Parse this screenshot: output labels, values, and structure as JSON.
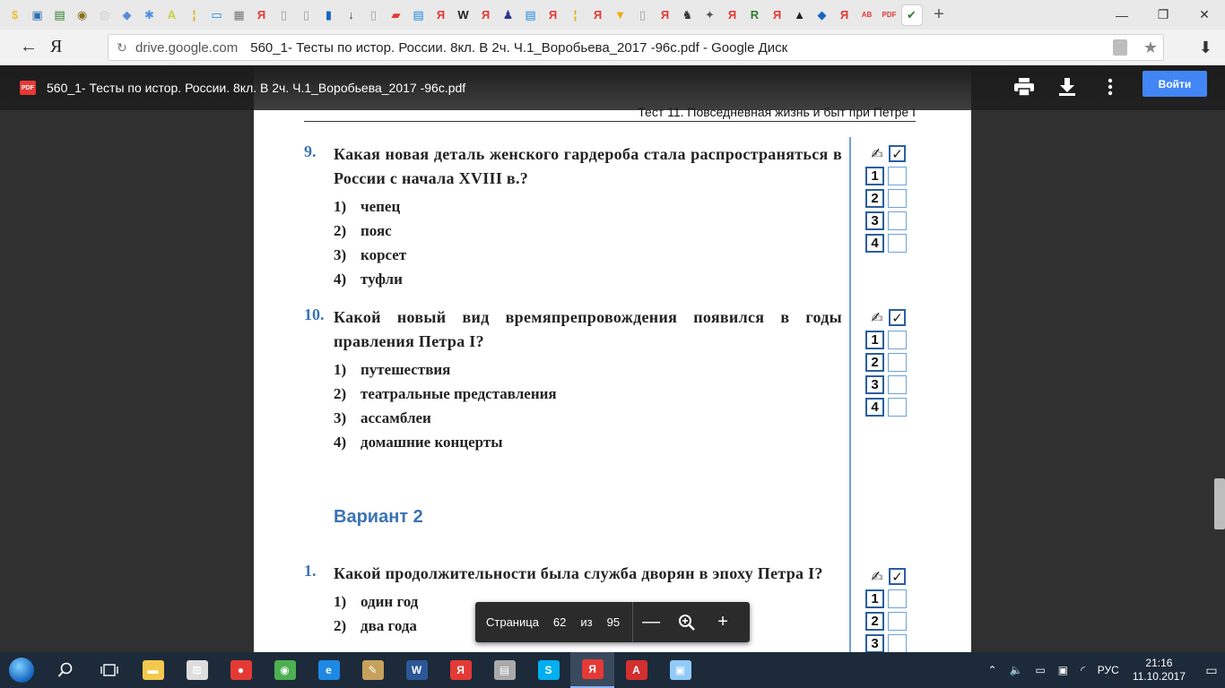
{
  "browser": {
    "tab_icons": [
      {
        "glyph": "$",
        "color": "#e9c23a"
      },
      {
        "glyph": "▣",
        "color": "#2f6fb3"
      },
      {
        "glyph": "▤",
        "color": "#2e7d32"
      },
      {
        "glyph": "◉",
        "color": "#8d6e1f"
      },
      {
        "glyph": "◎",
        "color": "#c8c8c8"
      },
      {
        "glyph": "◆",
        "color": "#5b8bd6"
      },
      {
        "glyph": "✱",
        "color": "#4a90e2"
      },
      {
        "glyph": "A",
        "color": "#c6d33b"
      },
      {
        "glyph": "¦",
        "color": "#e0b000"
      },
      {
        "glyph": "▭",
        "color": "#1e88e5"
      },
      {
        "glyph": "▦",
        "color": "#777777"
      },
      {
        "glyph": "Я",
        "color": "#e53935"
      },
      {
        "glyph": "▯",
        "color": "#9e9e9e"
      },
      {
        "glyph": "▯",
        "color": "#9e9e9e"
      },
      {
        "glyph": "▮",
        "color": "#1565c0"
      },
      {
        "glyph": "↓",
        "color": "#424242"
      },
      {
        "glyph": "▯",
        "color": "#9e9e9e"
      },
      {
        "glyph": "▰",
        "color": "#e53935"
      },
      {
        "glyph": "▤",
        "color": "#1e88e5"
      },
      {
        "glyph": "Я",
        "color": "#e53935"
      },
      {
        "glyph": "W",
        "color": "#222222"
      },
      {
        "glyph": "Я",
        "color": "#e53935"
      },
      {
        "glyph": "♟",
        "color": "#283593"
      },
      {
        "glyph": "▤",
        "color": "#1e88e5"
      },
      {
        "glyph": "Я",
        "color": "#e53935"
      },
      {
        "glyph": "¦",
        "color": "#e0b000"
      },
      {
        "glyph": "Я",
        "color": "#e53935"
      },
      {
        "glyph": "▼",
        "color": "#f2a900"
      },
      {
        "glyph": "▯",
        "color": "#9e9e9e"
      },
      {
        "glyph": "Я",
        "color": "#e53935"
      },
      {
        "glyph": "♞",
        "color": "#333333"
      },
      {
        "glyph": "✦",
        "color": "#555555"
      },
      {
        "glyph": "Я",
        "color": "#e53935"
      },
      {
        "glyph": "R",
        "color": "#2e7d32"
      },
      {
        "glyph": "Я",
        "color": "#e53935"
      },
      {
        "glyph": "▲",
        "color": "#222222"
      },
      {
        "glyph": "◆",
        "color": "#1565c0"
      },
      {
        "glyph": "Я",
        "color": "#e53935"
      },
      {
        "glyph": "AB",
        "color": "#e53935"
      },
      {
        "glyph": "PDF",
        "color": "#e53935"
      },
      {
        "glyph": "✔",
        "color": "#2e7d32"
      }
    ],
    "active_tab_index": 40,
    "new_tab": "+",
    "window_controls": [
      "—",
      "❐",
      "✕"
    ],
    "back_label": "←",
    "ya_logo": "Я",
    "url_domain": "drive.google.com",
    "url_title": "560_1- Тесты по истор. России. 8кл. В 2ч. Ч.1_Воробьева_2017 -96с.pdf - Google Диск"
  },
  "viewer": {
    "pdf_badge": "PDF",
    "file_title": "560_1- Тесты по истор. России. 8кл. В 2ч. Ч.1_Воробьева_2017 -96с.pdf",
    "signin_label": "Войти",
    "page": {
      "header": "Тест 11. Повседневная жизнь и быт при Петре I",
      "questions": [
        {
          "num": "9.",
          "text": "Какая новая деталь женского гардероба стала распространяться в России с начала XVIII в.?",
          "options": [
            {
              "no": "1)",
              "text": "чепец"
            },
            {
              "no": "2)",
              "text": "пояс"
            },
            {
              "no": "3)",
              "text": "корсет"
            },
            {
              "no": "4)",
              "text": "туфли"
            }
          ]
        },
        {
          "num": "10.",
          "text": "Какой новый вид времяпрепровождения появился в годы правления Петра I?",
          "options": [
            {
              "no": "1)",
              "text": "путешествия"
            },
            {
              "no": "2)",
              "text": "театральные представления"
            },
            {
              "no": "3)",
              "text": "ассамблеи"
            },
            {
              "no": "4)",
              "text": "домашние концерты"
            }
          ]
        },
        {
          "num": "1.",
          "text": "Какой продолжительности была служба дворян в эпоху Петра I?",
          "options": [
            {
              "no": "1)",
              "text": "один год"
            },
            {
              "no": "2)",
              "text": "два года"
            }
          ]
        }
      ],
      "variant_label": "Вариант 2",
      "answer_numbers": [
        "1",
        "2",
        "3",
        "4"
      ]
    },
    "page_control": {
      "label": "Страница",
      "current": "62",
      "of": "из",
      "total": "95",
      "zoom_out": "—",
      "zoom_in": "+"
    }
  },
  "taskbar": {
    "apps": [
      {
        "name": "explorer",
        "glyph": "▬",
        "color": "#f2c94c"
      },
      {
        "name": "store",
        "glyph": "⊞",
        "color": "#dddddd"
      },
      {
        "name": "media",
        "glyph": "●",
        "color": "#e53935"
      },
      {
        "name": "chrome",
        "glyph": "◉",
        "color": "#4caf50"
      },
      {
        "name": "edge",
        "glyph": "e",
        "color": "#1e88e5"
      },
      {
        "name": "paint",
        "glyph": "✎",
        "color": "#c6a15b"
      },
      {
        "name": "word",
        "glyph": "W",
        "color": "#2b5797"
      },
      {
        "name": "yandex",
        "glyph": "Я",
        "color": "#e53935"
      },
      {
        "name": "printer",
        "glyph": "▤",
        "color": "#aaaaaa"
      },
      {
        "name": "skype",
        "glyph": "S",
        "color": "#00aff0"
      },
      {
        "name": "yandex-browser",
        "glyph": "Я",
        "color": "#e53935"
      },
      {
        "name": "acrobat",
        "glyph": "A",
        "color": "#d32f2f"
      },
      {
        "name": "monitor",
        "glyph": "▣",
        "color": "#90caf9"
      }
    ],
    "active_app_index": 10,
    "lang": "РУС",
    "time": "21:16",
    "date": "11.10.2017"
  }
}
